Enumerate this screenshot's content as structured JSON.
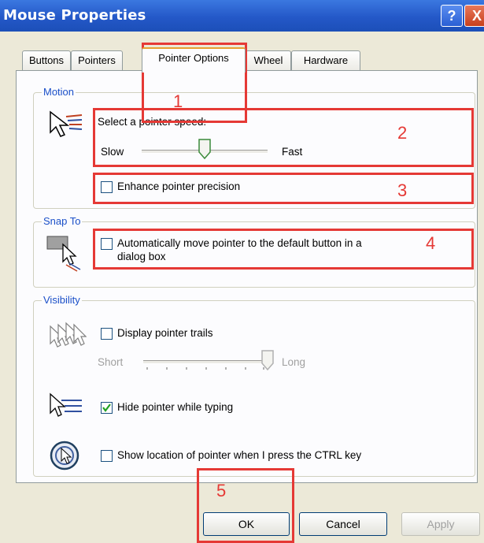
{
  "window": {
    "title": "Mouse Properties",
    "help_label": "?",
    "close_label": "X"
  },
  "tabs": [
    {
      "label": "Buttons"
    },
    {
      "label": "Pointers"
    },
    {
      "label": "Pointer Options"
    },
    {
      "label": "Wheel"
    },
    {
      "label": "Hardware"
    }
  ],
  "active_tab": "Pointer Options",
  "motion": {
    "group_label": "Motion",
    "speed_label": "Select a pointer speed:",
    "slow_label": "Slow",
    "fast_label": "Fast",
    "speed_fraction": 0.5,
    "precision_label": "Enhance pointer precision",
    "precision_checked": false
  },
  "snap_to": {
    "group_label": "Snap To",
    "auto_move_label_line1": "Automatically move pointer to the default button in a",
    "auto_move_label_line2": "dialog box",
    "auto_move_checked": false
  },
  "visibility": {
    "group_label": "Visibility",
    "trails_label": "Display pointer trails",
    "trails_checked": false,
    "short_label": "Short",
    "long_label": "Long",
    "trail_fraction": 1.0,
    "hide_label": "Hide pointer while typing",
    "hide_checked": true,
    "ctrl_label": "Show location of pointer when I press the CTRL key",
    "ctrl_checked": false
  },
  "buttons": {
    "ok": "OK",
    "cancel": "Cancel",
    "apply": "Apply"
  },
  "annotations": [
    "1",
    "2",
    "3",
    "4",
    "5"
  ],
  "colors": {
    "annotation": "#e53935",
    "titlebar": "#2458c8",
    "legend": "#1a4fc8"
  }
}
